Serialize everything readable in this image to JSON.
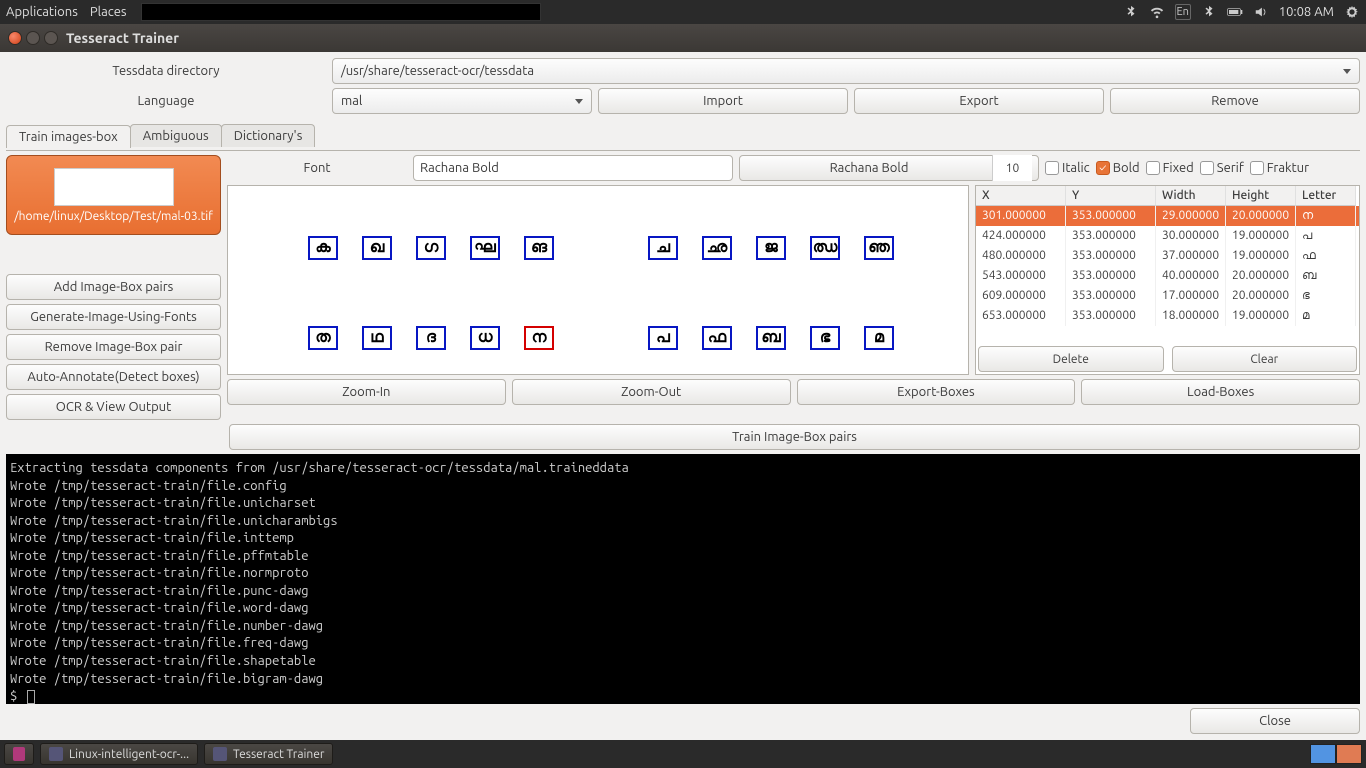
{
  "topbar": {
    "menu_apps": "Applications",
    "menu_places": "Places",
    "lang": "En",
    "clock": "10:08 AM"
  },
  "window": {
    "title": "Tesseract Trainer"
  },
  "form": {
    "tessdata_label": "Tessdata directory",
    "tessdata_path": "/usr/share/tesseract-ocr/tessdata",
    "language_label": "Language",
    "language_value": "mal",
    "import_btn": "Import",
    "export_btn": "Export",
    "remove_btn": "Remove"
  },
  "tabs": {
    "train": "Train images-box",
    "ambig": "Ambiguous",
    "dict": "Dictionary's"
  },
  "font": {
    "label": "Font",
    "name": "Rachana Bold",
    "display": "Rachana Bold",
    "size": "10",
    "italic": "Italic",
    "bold": "Bold",
    "fixed": "Fixed",
    "serif": "Serif",
    "fraktur": "Fraktur"
  },
  "imgitem": {
    "path": "/home/linux/Desktop/Test/mal-03.tif"
  },
  "leftbtns": {
    "add": "Add Image-Box pairs",
    "gen": "Generate-Image-Using-Fonts",
    "rem": "Remove Image-Box pair",
    "auto": "Auto-Annotate(Detect boxes)",
    "ocr": "OCR & View Output"
  },
  "grid": {
    "headers": {
      "x": "X",
      "y": "Y",
      "w": "Width",
      "h": "Height",
      "l": "Letter"
    },
    "rows": [
      {
        "x": "301.000000",
        "y": "353.000000",
        "w": "29.000000",
        "h": "20.000000",
        "l": "ന"
      },
      {
        "x": "424.000000",
        "y": "353.000000",
        "w": "30.000000",
        "h": "19.000000",
        "l": "പ"
      },
      {
        "x": "480.000000",
        "y": "353.000000",
        "w": "37.000000",
        "h": "19.000000",
        "l": "ഫ"
      },
      {
        "x": "543.000000",
        "y": "353.000000",
        "w": "40.000000",
        "h": "20.000000",
        "l": "ബ"
      },
      {
        "x": "609.000000",
        "y": "353.000000",
        "w": "17.000000",
        "h": "20.000000",
        "l": "ഭ"
      },
      {
        "x": "653.000000",
        "y": "353.000000",
        "w": "18.000000",
        "h": "19.000000",
        "l": "മ"
      }
    ],
    "delete": "Delete",
    "clear": "Clear"
  },
  "zoom": {
    "in": "Zoom-In",
    "out": "Zoom-Out",
    "export": "Export-Boxes",
    "load": "Load-Boxes"
  },
  "train": {
    "train_pairs": "Train Image-Box pairs"
  },
  "terminal_lines": [
    "Extracting tessdata components from /usr/share/tesseract-ocr/tessdata/mal.traineddata",
    "Wrote /tmp/tesseract-train/file.config",
    "Wrote /tmp/tesseract-train/file.unicharset",
    "Wrote /tmp/tesseract-train/file.unicharambigs",
    "Wrote /tmp/tesseract-train/file.inttemp",
    "Wrote /tmp/tesseract-train/file.pffmtable",
    "Wrote /tmp/tesseract-train/file.normproto",
    "Wrote /tmp/tesseract-train/file.punc-dawg",
    "Wrote /tmp/tesseract-train/file.word-dawg",
    "Wrote /tmp/tesseract-train/file.number-dawg",
    "Wrote /tmp/tesseract-train/file.freq-dawg",
    "Wrote /tmp/tesseract-train/file.shapetable",
    "Wrote /tmp/tesseract-train/file.bigram-dawg"
  ],
  "terminal_prompt": "$ ",
  "footer": {
    "close": "Close"
  },
  "taskbar": {
    "task1": "Linux-intelligent-ocr-...",
    "task2": "Tesseract Trainer"
  },
  "glyphs_row1": [
    "ക",
    "ഖ",
    "ഗ",
    "ഘ",
    "ങ",
    "ച",
    "ഛ",
    "ജ",
    "ഝ",
    "ഞ"
  ],
  "glyphs_row2": [
    "ത",
    "ഥ",
    "ദ",
    "ധ",
    "ന",
    "പ",
    "ഫ",
    "ബ",
    "ഭ",
    "മ"
  ]
}
